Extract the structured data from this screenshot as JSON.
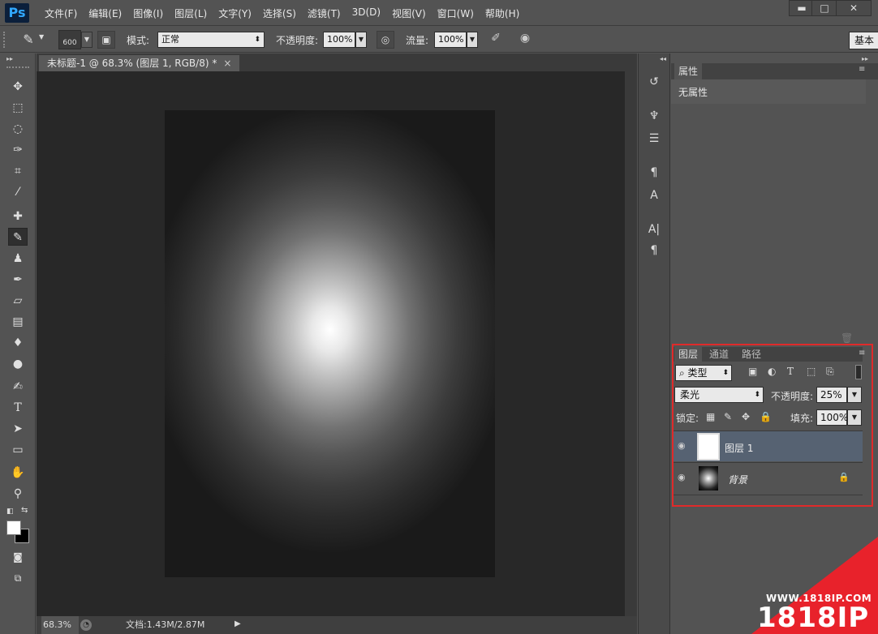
{
  "app": {
    "logo": "Ps"
  },
  "menu": [
    "文件(F)",
    "编辑(E)",
    "图像(I)",
    "图层(L)",
    "文字(Y)",
    "选择(S)",
    "滤镜(T)",
    "3D(D)",
    "视图(V)",
    "窗口(W)",
    "帮助(H)"
  ],
  "window_controls": {
    "minimize": "▬",
    "maximize": "□",
    "close": "✕"
  },
  "options": {
    "brush_size": "600",
    "mode_label": "模式:",
    "mode_value": "正常",
    "opacity_label": "不透明度:",
    "opacity_value": "100%",
    "flow_label": "流量:",
    "flow_value": "100%",
    "workspace": "基本"
  },
  "document": {
    "tab_title": "未标题-1 @ 68.3% (图层 1, RGB/8) *",
    "close": "×"
  },
  "status": {
    "zoom": "68.3%",
    "doc_info": "文档:1.43M/2.87M"
  },
  "properties": {
    "tab": "属性",
    "body": "无属性"
  },
  "layers_panel": {
    "tabs": [
      "图层",
      "通道",
      "路径"
    ],
    "filter": "类型",
    "blend_mode": "柔光",
    "opacity_label": "不透明度:",
    "opacity_value": "25%",
    "lock_label": "锁定:",
    "fill_label": "填充:",
    "fill_value": "100%",
    "layers": [
      {
        "name": "图层 1",
        "selected": true
      },
      {
        "name": "背景",
        "locked": true
      }
    ]
  },
  "watermark": {
    "url": "WWW.1818IP.COM",
    "brand": "1818IP"
  },
  "colors": {
    "panel": "#535353",
    "doc_bg": "#282828",
    "selected_layer": "#566272",
    "highlight_box": "#e02a2a",
    "watermark": "#e8222b",
    "ps_blue": "#31a8ff"
  }
}
